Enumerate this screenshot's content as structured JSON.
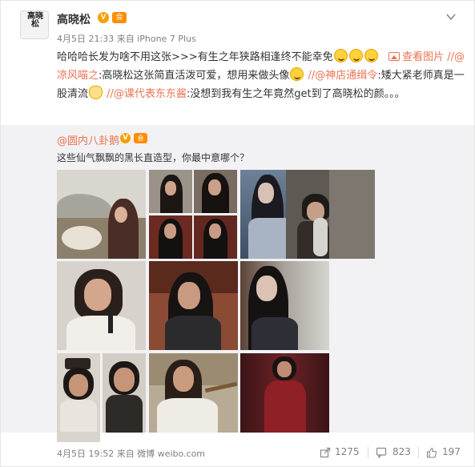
{
  "post": {
    "author": "高晓松",
    "avatar_text": "高晓松",
    "verified_badge": "V",
    "member_badge": "会",
    "meta": "4月5日 21:33 来自 iPhone 7 Plus",
    "text_part1": "哈哈哈长发为啥不用这张>>>有生之年狭路相逢终不能幸免",
    "view_image_label": "查看图片",
    "mention1": "//@凉风喵之",
    "text_part2": ":高晓松这张简直活泼可爱，想用来做头像",
    "mention2": "//@神店通缉令",
    "text_part3": ":矮大紧老师真是一股清流",
    "mention3": "//@课代表东东酱",
    "text_part4": ":没想到我有生之年竟然get到了高晓松的颜。。。"
  },
  "repost": {
    "author": "@圆内八卦鹅",
    "verified_badge": "V",
    "member_badge": "会",
    "text": "这些仙气飘飘的黑长直造型，你最中意哪个？"
  },
  "footer": {
    "meta": "4月5日 19:52 来自 微博 weibo.com",
    "reposts": "1275",
    "comments": "823",
    "likes": "197"
  },
  "colors": {
    "link": "#eb7350",
    "meta_gray": "#808080",
    "repost_bg": "#f2f2f5",
    "badge_orange": "#f7a000"
  },
  "icons": [
    "chevron-down-icon",
    "laugh-cry-emoji",
    "cry-emoji",
    "grin-emoji",
    "picture-icon",
    "smile-emoji",
    "pray-emoji",
    "share-icon",
    "comment-icon",
    "like-icon"
  ]
}
